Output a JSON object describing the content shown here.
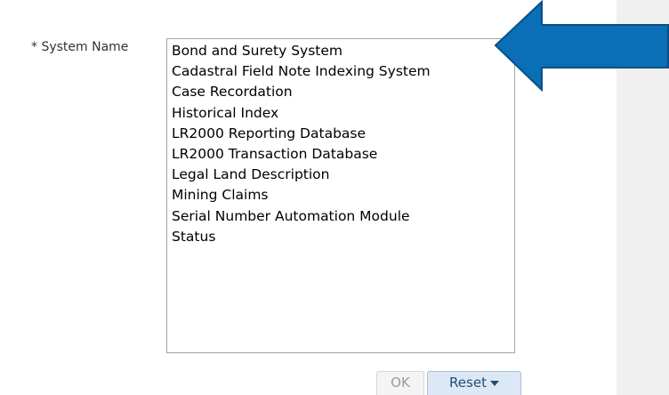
{
  "field": {
    "label": "* System Name"
  },
  "systems": [
    "Bond and Surety System",
    "Cadastral Field Note Indexing System",
    "Case Recordation",
    "Historical Index",
    "LR2000 Reporting Database",
    "LR2000 Transaction Database",
    "Legal Land Description",
    "Mining Claims",
    "Serial Number Automation Module",
    "Status"
  ],
  "buttons": {
    "ok_label": "OK",
    "reset_label": "Reset"
  },
  "colors": {
    "arrow_fill": "#0b6fb7",
    "arrow_stroke": "#0a4f86",
    "reset_bg": "#dce8f5",
    "page_bg": "#f0f0f0"
  }
}
